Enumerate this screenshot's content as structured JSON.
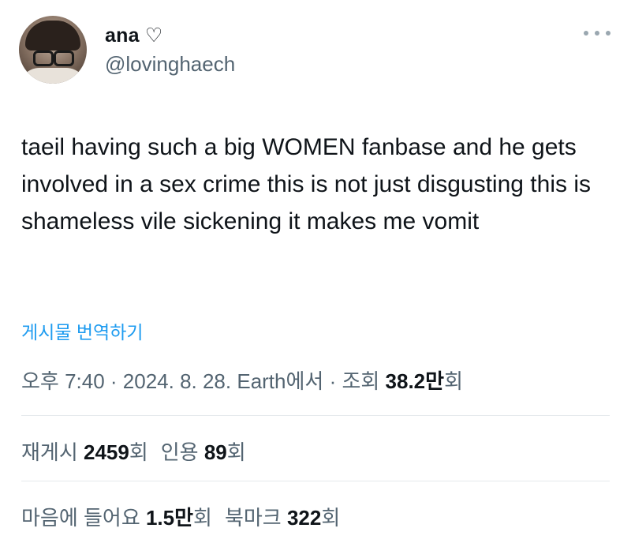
{
  "author": {
    "display_name": "ana ♡",
    "handle": "@lovinghaech"
  },
  "tweet": {
    "text": "taeil having such a big WOMEN fanbase and he gets involved in a sex crime this is not just disgusting this is shameless vile sickening it makes me vomit",
    "translate_label": "게시물 번역하기"
  },
  "meta": {
    "time": "오후 7:40",
    "sep1": " · ",
    "date": "2024. 8. 28.",
    "location": " Earth에서",
    "sep2": " · ",
    "views_label": "조회 ",
    "views_value": "38.2만",
    "views_suffix": "회"
  },
  "stats": {
    "reposts_label": "재게시 ",
    "reposts_value": "2459",
    "reposts_suffix": "회",
    "quotes_label": "인용 ",
    "quotes_value": "89",
    "quotes_suffix": "회",
    "likes_label": "마음에 들어요 ",
    "likes_value": "1.5만",
    "likes_suffix": "회",
    "bookmarks_label": "북마크 ",
    "bookmarks_value": "322",
    "bookmarks_suffix": "회"
  },
  "icons": {
    "more": "more-horizontal-icon"
  },
  "colors": {
    "link": "#1d9bf0",
    "secondary_text": "#536471",
    "primary_text": "#0f1419"
  }
}
